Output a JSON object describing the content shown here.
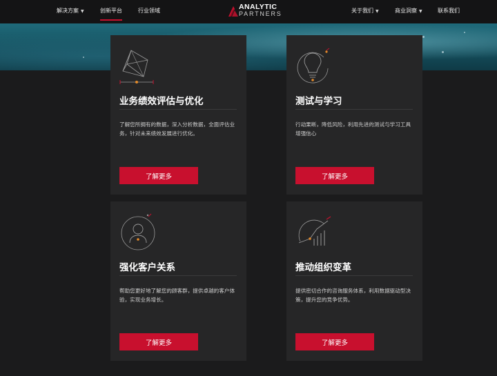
{
  "header": {
    "nav_left": [
      {
        "label": "解决方案",
        "has_caret": true
      },
      {
        "label": "创新平台",
        "has_caret": false,
        "active": true
      },
      {
        "label": "行业领域",
        "has_caret": false
      }
    ],
    "nav_right": [
      {
        "label": "关于我们",
        "has_caret": true
      },
      {
        "label": "商业洞察",
        "has_caret": true
      },
      {
        "label": "联系我们",
        "has_caret": false
      }
    ],
    "logo_line1": "ANALYTIC",
    "logo_line2": "PARTNERS",
    "caret_glyph": "▼"
  },
  "colors": {
    "accent": "#c8102e",
    "background": "#1b1b1c",
    "card": "#262627",
    "hero": "#1f6a7a"
  },
  "cards": [
    {
      "icon": "cube-measure-icon",
      "title": "业务绩效评估与优化",
      "desc": "了解您所拥有的数据，深入分析数据，全面评估业务，针对未来绩效发展进行优化。",
      "button": "了解更多"
    },
    {
      "icon": "lightbulb-icon",
      "title": "测试与学习",
      "desc": "行动果断，降低风险，利用先进的测试与学习工具增强信心",
      "button": "了解更多"
    },
    {
      "icon": "customer-person-icon",
      "title": "强化客户关系",
      "desc": "帮助您更好地了解您的顾客群，提供卓越的客户体验，实现业务增长。",
      "button": "了解更多"
    },
    {
      "icon": "growth-chart-icon",
      "title": "推动组织变革",
      "desc": "提供密切合作的咨询服务体系，利用数据驱动型决策，提升您的竞争优势。",
      "button": "了解更多"
    }
  ]
}
